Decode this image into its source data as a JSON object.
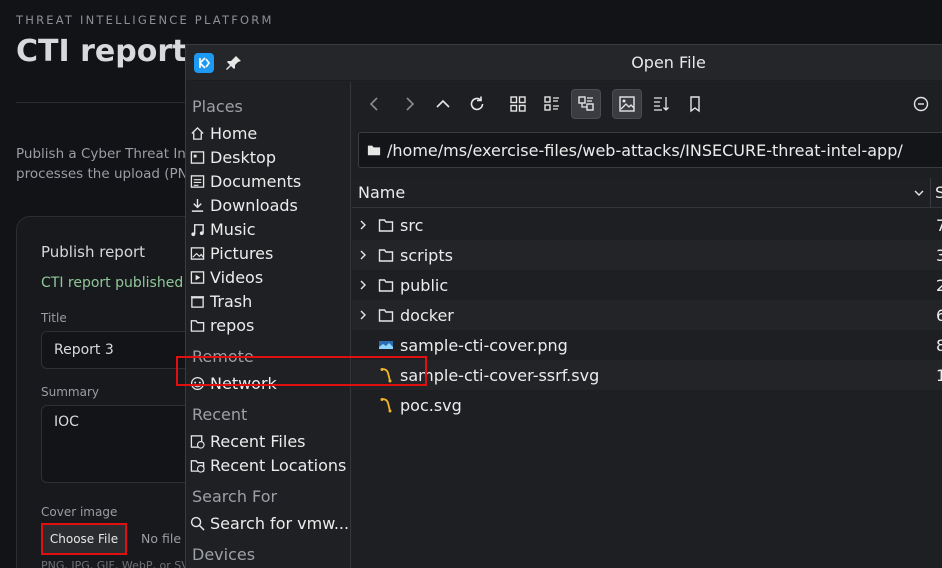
{
  "page": {
    "eyebrow": "THREAT INTELLIGENCE PLATFORM",
    "title": "CTI reports",
    "intro_line1": "Publish a Cyber Threat Int",
    "intro_line2": "processes the upload (PN",
    "card_title": "Publish report",
    "success_msg": "CTI report published t",
    "title_label": "Title",
    "title_value": "Report 3",
    "summary_label": "Summary",
    "summary_value": "IOC",
    "cover_label": "Cover image",
    "choose_file": "Choose File",
    "no_file": "No file c",
    "hint": "PNG, JPG, GIF, WebP, or SVG"
  },
  "dialog": {
    "title": "Open File",
    "sidebar": {
      "places_header": "Places",
      "places": [
        {
          "label": "Home",
          "icon": "home-icon"
        },
        {
          "label": "Desktop",
          "icon": "desktop-icon"
        },
        {
          "label": "Documents",
          "icon": "documents-icon"
        },
        {
          "label": "Downloads",
          "icon": "downloads-icon"
        },
        {
          "label": "Music",
          "icon": "music-icon"
        },
        {
          "label": "Pictures",
          "icon": "pictures-icon"
        },
        {
          "label": "Videos",
          "icon": "videos-icon"
        },
        {
          "label": "Trash",
          "icon": "trash-icon"
        },
        {
          "label": "repos",
          "icon": "folder-icon"
        }
      ],
      "remote_header": "Remote",
      "remote": [
        {
          "label": "Network",
          "icon": "network-icon"
        }
      ],
      "recent_header": "Recent",
      "recent": [
        {
          "label": "Recent Files",
          "icon": "recent-files-icon"
        },
        {
          "label": "Recent Locations",
          "icon": "recent-locations-icon"
        }
      ],
      "search_header": "Search For",
      "search": [
        {
          "label": "Search for vmw...",
          "icon": "search-icon"
        }
      ],
      "devices_header": "Devices"
    },
    "path": "/home/ms/exercise-files/web-attacks/INSECURE-threat-intel-app/",
    "columns": {
      "name": "Name",
      "size": "S"
    },
    "files": [
      {
        "name": "src",
        "type": "folder",
        "size": "7"
      },
      {
        "name": "scripts",
        "type": "folder",
        "size": "3"
      },
      {
        "name": "public",
        "type": "folder",
        "size": "2"
      },
      {
        "name": "docker",
        "type": "folder",
        "size": "6"
      },
      {
        "name": "sample-cti-cover.png",
        "type": "png",
        "size": "8"
      },
      {
        "name": "sample-cti-cover-ssrf.svg",
        "type": "svg",
        "size": "1"
      },
      {
        "name": "poc.svg",
        "type": "svg",
        "size": ""
      }
    ]
  },
  "colors": {
    "highlight": "#e01010",
    "accent": "#1d99f3",
    "success": "#8fc79a"
  }
}
